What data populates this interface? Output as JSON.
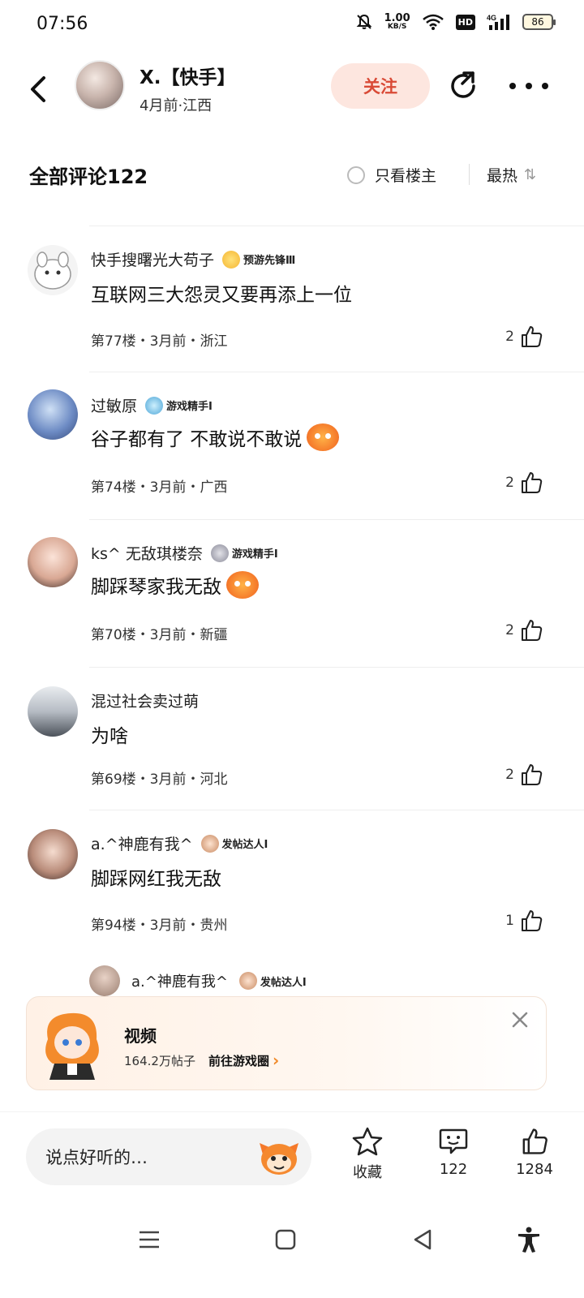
{
  "status_bar": {
    "time": "07:56",
    "net_speed_value": "1.00",
    "net_speed_unit": "KB/S",
    "hd_label": "HD",
    "network_label": "4G",
    "battery": "86"
  },
  "header": {
    "author_name": "X.【快手】",
    "author_meta": "4月前·江西",
    "follow_label": "关注"
  },
  "comment_bar": {
    "title": "全部评论122",
    "only_op_label": "只看楼主",
    "sort_label": "最热"
  },
  "comments": [
    {
      "user": "快手搜曙光大苟子",
      "badge": "预游先锋Ⅲ",
      "text": "互联网三大怨灵又要再添上一位",
      "meta": "第77楼・3月前・浙江",
      "likes": "2"
    },
    {
      "user": "过敏原",
      "badge": "游戏精手Ⅰ",
      "text": "谷子都有了 不敢说不敢说",
      "meta": "第74楼・3月前・广西",
      "likes": "2"
    },
    {
      "user": "ks^ 无敌琪楼奈",
      "badge": "游戏精手Ⅰ",
      "text": "脚踩琴家我无敌",
      "meta": "第70楼・3月前・新疆",
      "likes": "2"
    },
    {
      "user": "混过社会卖过萌",
      "badge": "",
      "text": "为啥",
      "meta": "第69楼・3月前・河北",
      "likes": "2"
    },
    {
      "user": "a.^神鹿有我^",
      "badge": "发帖达人Ⅰ",
      "text": "脚踩网红我无敌",
      "meta": "第94楼・3月前・贵州",
      "likes": "1"
    }
  ],
  "reply_preview": {
    "user": "a.^神鹿有我^",
    "badge": "发帖达人Ⅰ"
  },
  "banner": {
    "title": "视频",
    "posts": "164.2万帖子",
    "link": "前往游戏圈"
  },
  "bottom_bar": {
    "input_placeholder": "说点好听的…",
    "favorite_label": "收藏",
    "comment_count": "122",
    "like_count": "1284"
  },
  "colors": {
    "follow_bg": "#fde6df",
    "follow_text": "#d94a36",
    "accent_orange": "#f08a2a"
  }
}
